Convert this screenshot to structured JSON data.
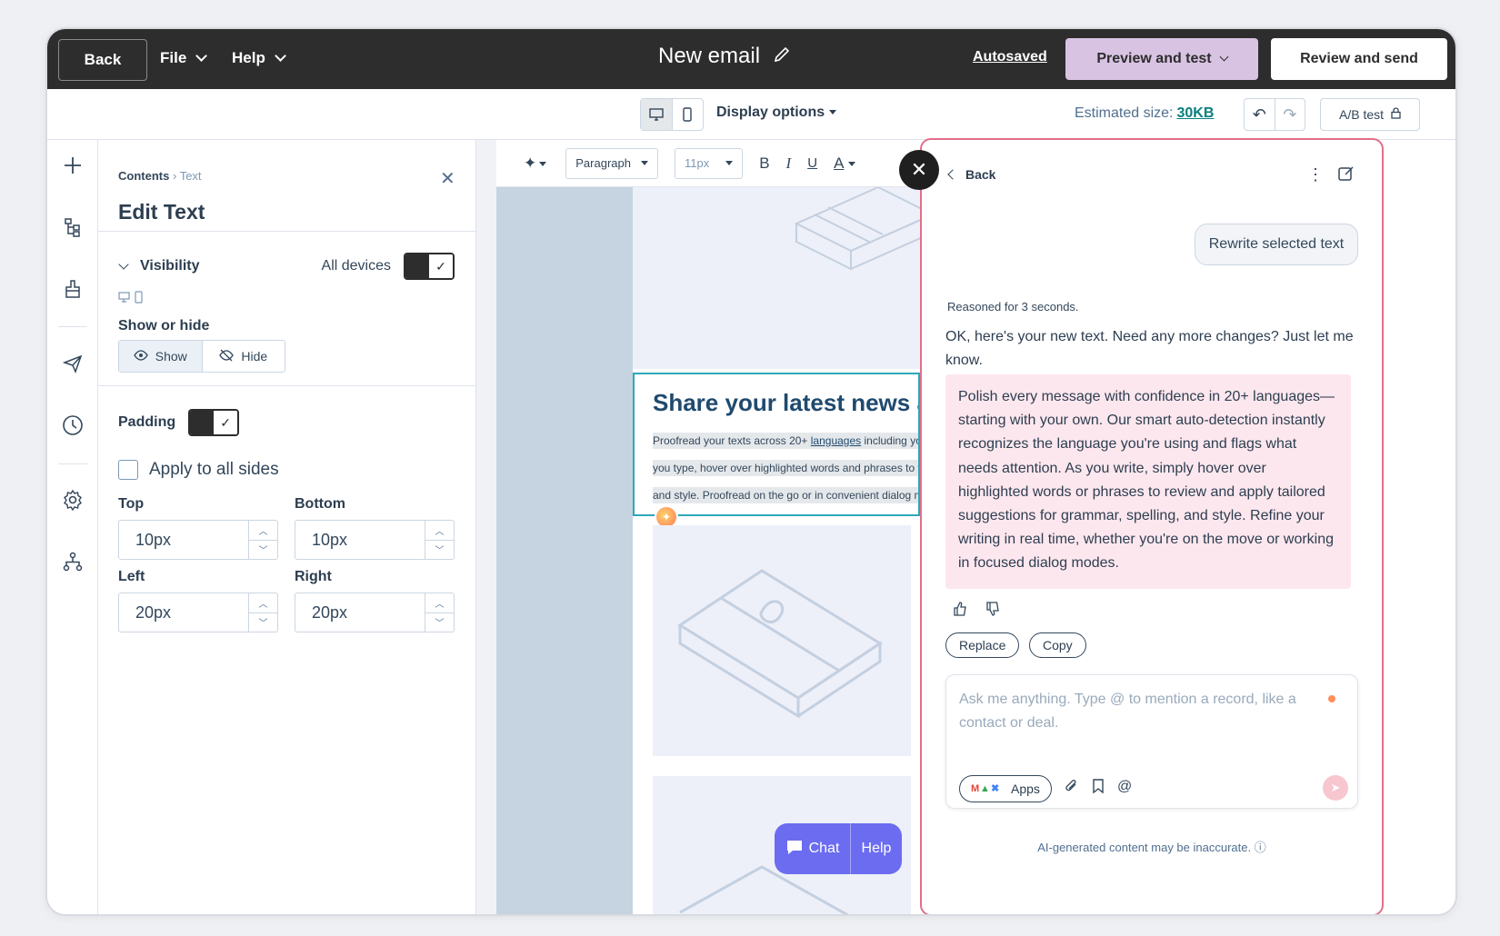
{
  "topbar": {
    "back_label": "Back",
    "file_label": "File",
    "help_label": "Help",
    "title": "New email",
    "autosaved_label": "Autosaved",
    "preview_label": "Preview and test",
    "review_label": "Review and send"
  },
  "toolbar": {
    "display_options_label": "Display options",
    "estimated_label": "Estimated size:",
    "estimated_value": "30KB",
    "abtest_label": "A/B test"
  },
  "rail": {
    "icons": [
      "plus-icon",
      "tree-icon",
      "paint-brush-icon",
      "send-icon",
      "clock-icon",
      "gear-icon",
      "sitemap-icon"
    ]
  },
  "panel": {
    "crumb_root": "Contents",
    "crumb_sep": "›",
    "crumb_leaf": "Text",
    "title": "Edit Text",
    "visibility_label": "Visibility",
    "all_devices_label": "All devices",
    "show_or_hide_label": "Show or hide",
    "show_label": "Show",
    "hide_label": "Hide",
    "padding_label": "Padding",
    "apply_all_label": "Apply to all sides",
    "top_label": "Top",
    "top_value": "10px",
    "bottom_label": "Bottom",
    "bottom_value": "10px",
    "left_label": "Left",
    "left_value": "20px",
    "right_label": "Right",
    "right_value": "20px"
  },
  "canvas": {
    "format_select": "Paragraph",
    "size_select": "11px",
    "headline": "Share your latest news a",
    "line1_pre": "Proofread your texts across 20+ ",
    "line1_link": "languages",
    "line1_post": " including yo",
    "line2": "you type, hover over highlighted words and phrases to v",
    "line3": "and style. Proofread on the go or in convenient dialog m",
    "chat_label": "Chat",
    "help_label": "Help"
  },
  "ai": {
    "back_label": "Back",
    "user_message": "Rewrite selected text",
    "reasoned": "Reasoned for 3 seconds.",
    "reply_intro": "OK, here's your new text. Need any more changes? Just let me know.",
    "result": "Polish every message with confidence in 20+ languages—starting with your own. Our smart auto-detection instantly recognizes the language you're using and flags what needs attention. As you write, simply hover over highlighted words or phrases to review and apply tailored suggestions for grammar, spelling, and style. Refine your writing in real time, whether you're on the move or working in focused dialog modes.",
    "replace_label": "Replace",
    "copy_label": "Copy",
    "composer_placeholder": "Ask me anything. Type @ to mention a record, like a contact or deal.",
    "apps_label": "Apps",
    "disclaimer": "AI-generated content may be inaccurate."
  },
  "colors": {
    "topbar_bg": "#2d2d2d",
    "preview_btn": "#d9c3e3",
    "ai_border": "#e26f8a",
    "ai_result_bg": "#fde7ee",
    "chat_btn": "#6b6cf0",
    "accent_link": "#0a7e7e"
  }
}
